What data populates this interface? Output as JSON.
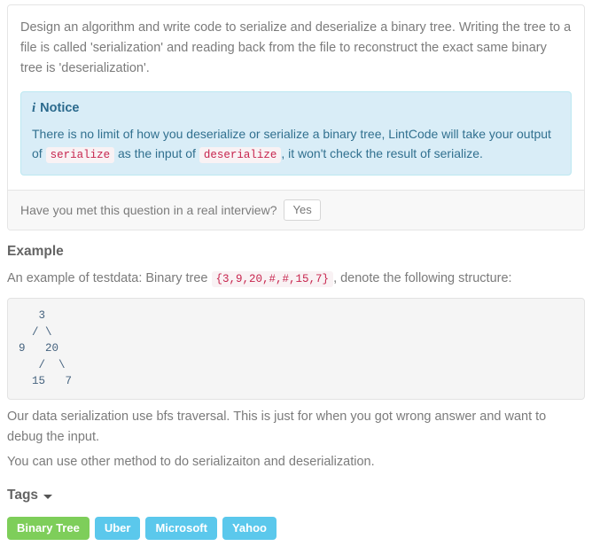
{
  "problem": {
    "description": "Design an algorithm and write code to serialize and deserialize a binary tree. Writing the tree to a file is called 'serialization' and reading back from the file to reconstruct the exact same binary tree is 'deserialization'.",
    "notice": {
      "icon": "info-icon",
      "title": "Notice",
      "text_part1": "There is no limit of how you deserialize or serialize a binary tree, LintCode will take your output of",
      "code1": "serialize",
      "text_part2": "as the input of",
      "code2": "deserialize",
      "text_part3": ", it won't check the result of serialize."
    },
    "footer": {
      "question": "Have you met this question in a real interview?",
      "yes_label": "Yes"
    }
  },
  "example": {
    "title": "Example",
    "intro_part1": "An example of testdata: Binary tree",
    "intro_code": "{3,9,20,#,#,15,7}",
    "intro_part2": ", denote the following structure:",
    "tree_ascii": "   3\n  / \\\n9   20\n   /  \\\n  15   7",
    "note1": "Our data serialization use bfs traversal. This is just for when you got wrong answer and want to debug the input.",
    "note2": "You can use other method to do serializaiton and deserialization."
  },
  "tags": {
    "title": "Tags",
    "caret": "chevron-down-icon",
    "items": [
      {
        "label": "Binary Tree",
        "color": "#7ece5a"
      },
      {
        "label": "Uber",
        "color": "#5bc8ec"
      },
      {
        "label": "Microsoft",
        "color": "#5bc8ec"
      },
      {
        "label": "Yahoo",
        "color": "#5bc8ec"
      }
    ]
  },
  "colors": {
    "notice_bg": "#d9edf7",
    "notice_border": "#bce8f1",
    "notice_text": "#31708f",
    "inline_code_text": "#c7254e",
    "inline_code_bg": "#f9f2f4",
    "code_block_bg": "#f5f5f5",
    "body_text": "#7b7b7b",
    "tag_green": "#7ece5a",
    "tag_blue": "#5bc8ec"
  }
}
